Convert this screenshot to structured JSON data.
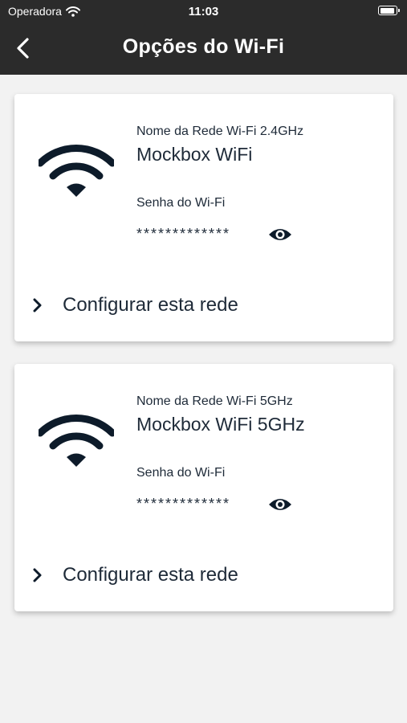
{
  "status_bar": {
    "carrier": "Operadora",
    "time": "11:03"
  },
  "header": {
    "title": "Opções do Wi-Fi"
  },
  "networks": [
    {
      "name_label": "Nome da Rede Wi-Fi 2.4GHz",
      "name": "Mockbox WiFi",
      "password_label": "Senha do Wi-Fi",
      "password": "*************",
      "configure_label": "Configurar esta rede"
    },
    {
      "name_label": "Nome da Rede Wi-Fi 5GHz",
      "name": "Mockbox WiFi 5GHz",
      "password_label": "Senha do Wi-Fi",
      "password": "*************",
      "configure_label": "Configurar esta rede"
    }
  ],
  "icons": {
    "back": "chevron-left-icon",
    "wifi": "wifi-icon",
    "eye": "eye-icon",
    "chevron": "chevron-right-icon"
  },
  "colors": {
    "header_bg": "#2b2b2b",
    "page_bg": "#f2f2f2",
    "card_bg": "#ffffff",
    "icon": "#0d1b2a",
    "text": "#1e2a38"
  }
}
